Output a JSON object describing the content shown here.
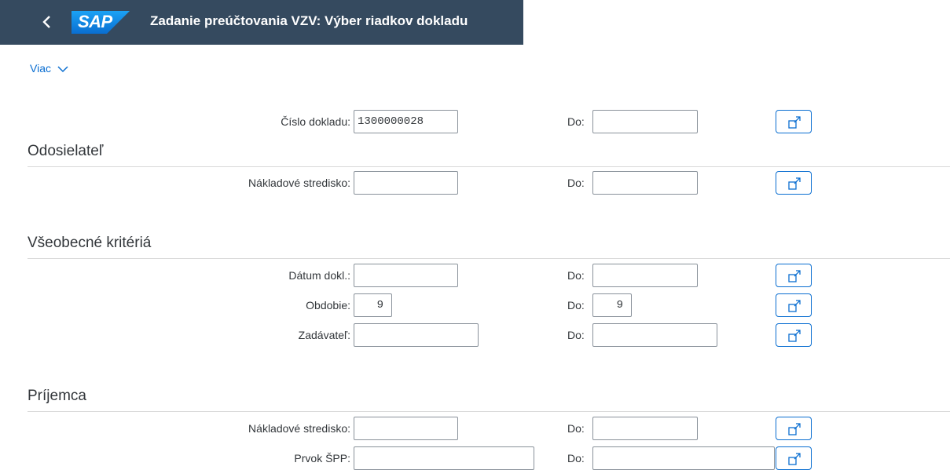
{
  "header": {
    "title": "Zadanie preúčtovania VZV: Výber riadkov dokladu",
    "logo": "SAP"
  },
  "toolbar": {
    "more_label": "Viac"
  },
  "doc": {
    "label": "Číslo dokladu:",
    "from": "1300000028",
    "to_label": "Do:",
    "to": ""
  },
  "sections": {
    "sender": "Odosielateľ",
    "general": "Všeobecné kritériá",
    "receiver": "Príjemca"
  },
  "sender": {
    "cost_center": {
      "label": "Nákladové stredisko:",
      "from": "",
      "to_label": "Do:",
      "to": ""
    }
  },
  "general": {
    "doc_date": {
      "label": "Dátum dokl.:",
      "from": "",
      "to_label": "Do:",
      "to": ""
    },
    "period": {
      "label": "Obdobie:",
      "from": "9",
      "to_label": "Do:",
      "to": "9"
    },
    "entered_by": {
      "label": "Zadávateľ:",
      "from": "",
      "to_label": "Do:",
      "to": ""
    }
  },
  "receiver": {
    "cost_center": {
      "label": "Nákladové stredisko:",
      "from": "",
      "to_label": "Do:",
      "to": ""
    },
    "wbs": {
      "label": "Prvok ŠPP:",
      "from": "",
      "to_label": "Do:",
      "to": ""
    }
  },
  "colors": {
    "shell": "#354a5f",
    "accent": "#0a6ed1"
  },
  "icons": {
    "back": "chevron-left-icon",
    "more": "chevron-down-icon",
    "multiple_selection": "multiple-selection-icon"
  }
}
